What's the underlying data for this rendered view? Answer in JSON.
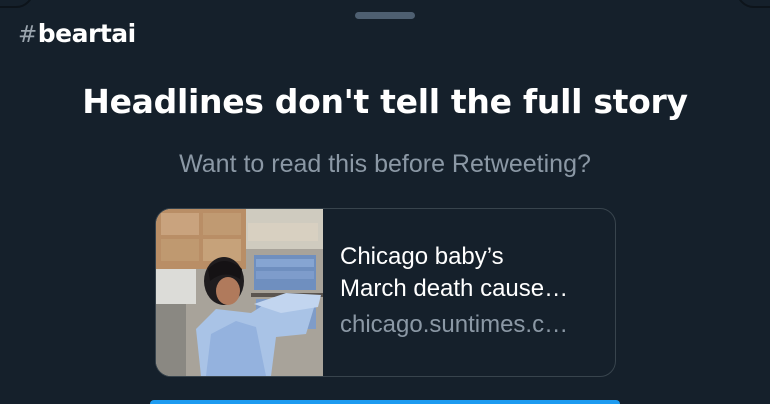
{
  "watermark": {
    "hash": "#",
    "brand": "beartai"
  },
  "prompt": {
    "headline": "Headlines don't tell the full story",
    "subtitle": "Want to read this before Retweeting?"
  },
  "link_card": {
    "title": "Chicago baby’s\nMarch death cause…",
    "domain": "chicago.suntimes.c…",
    "thumbnail_description": "photo"
  },
  "colors": {
    "background": "#15202b",
    "accent": "#1d9bf0",
    "secondary_text": "#8b98a5",
    "border": "#38444d"
  }
}
